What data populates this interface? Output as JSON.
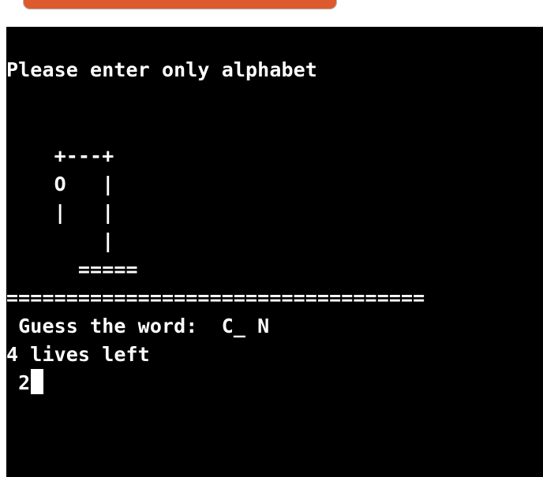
{
  "run_button": {
    "color": "#dc5a2e"
  },
  "terminal": {
    "background": "#000000",
    "foreground": "#ffffff",
    "message": "Please enter only alphabet",
    "hangman": [
      "    +---+",
      "    O   |",
      "    |   |",
      "        |",
      "      ====="
    ],
    "separator": "===================================",
    "guess_line": " Guess the word:  C_ N",
    "lives_line": "4 lives left",
    "input_value": " 2"
  }
}
